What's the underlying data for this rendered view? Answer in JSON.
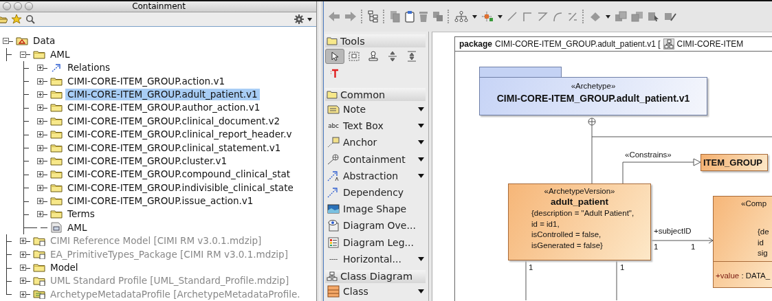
{
  "containment": {
    "title": "Containment",
    "tree": [
      {
        "label": "Data",
        "kind": "data",
        "selected": false,
        "children": [
          {
            "label": "AML",
            "kind": "folder",
            "selected": false,
            "children": [
              {
                "label": "Relations",
                "kind": "relations",
                "selected": false
              },
              {
                "label": "CIMI-CORE-ITEM_GROUP.action.v1",
                "kind": "folder",
                "selected": false
              },
              {
                "label": "CIMI-CORE-ITEM_GROUP.adult_patient.v1",
                "kind": "folder",
                "selected": true
              },
              {
                "label": "CIMI-CORE-ITEM_GROUP.author_action.v1",
                "kind": "folder",
                "selected": false
              },
              {
                "label": "CIMI-CORE-ITEM_GROUP.clinical_document.v2",
                "kind": "folder",
                "selected": false
              },
              {
                "label": "CIMI-CORE-ITEM_GROUP.clinical_report_header.v",
                "kind": "folder",
                "selected": false
              },
              {
                "label": "CIMI-CORE-ITEM_GROUP.clinical_statement.v1",
                "kind": "folder",
                "selected": false
              },
              {
                "label": "CIMI-CORE-ITEM_GROUP.cluster.v1",
                "kind": "folder",
                "selected": false
              },
              {
                "label": "CIMI-CORE-ITEM_GROUP.compound_clinical_stat",
                "kind": "folder",
                "selected": false
              },
              {
                "label": "CIMI-CORE-ITEM_GROUP.indivisible_clinical_state",
                "kind": "folder",
                "selected": false
              },
              {
                "label": "CIMI-CORE-ITEM_GROUP.issue_action.v1",
                "kind": "folder",
                "selected": false
              },
              {
                "label": "Terms",
                "kind": "folder",
                "selected": false
              },
              {
                "label": "AML",
                "kind": "diagram",
                "selected": false
              }
            ]
          },
          {
            "label": "CIMI Reference Model [CIMI RM v3.0.1.mdzip]",
            "kind": "module",
            "selected": false
          },
          {
            "label": "EA_PrimitiveTypes_Package [CIMI RM v3.0.1.mdzip]",
            "kind": "module",
            "selected": false
          },
          {
            "label": "Model",
            "kind": "folder",
            "selected": false
          },
          {
            "label": "UML Standard Profile [UML_Standard_Profile.mdzip]",
            "kind": "module",
            "selected": false
          },
          {
            "label": "ArchetypeMetadataProfile [ArchetypeMetadataProfile.",
            "kind": "profile",
            "selected": false
          }
        ]
      }
    ]
  },
  "palette": {
    "sections": [
      {
        "title": "Tools",
        "kind": "tools",
        "tools": [
          {
            "selected": true
          },
          {
            "selected": false
          },
          {
            "selected": false
          },
          {
            "selected": false
          },
          {
            "selected": false
          },
          {
            "selected": false
          }
        ]
      },
      {
        "title": "Common",
        "kind": "list",
        "items": [
          {
            "label": "Note",
            "kind": "note",
            "menu": true
          },
          {
            "label": "Text Box",
            "kind": "textbox",
            "glyph": "abc",
            "menu": true
          },
          {
            "label": "Anchor",
            "kind": "anchor",
            "menu": true
          },
          {
            "label": "Containment",
            "kind": "containment",
            "menu": true
          },
          {
            "label": "Abstraction",
            "kind": "abstraction",
            "menu": true
          },
          {
            "label": "Dependency",
            "kind": "dependency",
            "menu": false
          },
          {
            "label": "Image Shape",
            "kind": "image",
            "menu": false
          },
          {
            "label": "Diagram Ove...",
            "kind": "overview",
            "menu": false
          },
          {
            "label": "Diagram Leg...",
            "kind": "legend",
            "menu": false
          },
          {
            "label": "Horizontal...",
            "kind": "separator",
            "glyph": "----",
            "menu": true
          }
        ]
      },
      {
        "title": "Class Diagram",
        "kind": "list",
        "items": [
          {
            "label": "Class",
            "kind": "class",
            "menu": true
          }
        ]
      }
    ]
  },
  "diagram": {
    "frame_kind": "package",
    "frame_name": "CIMI-CORE-ITEM_GROUP.adult_patient.v1 [",
    "frame_diagram": "CIMI-CORE-ITEM",
    "package": {
      "stereotype": "«Archetype»",
      "name": "CIMI-CORE-ITEM_GROUP.adult_patient.v1"
    },
    "constraint": {
      "label": "«Constrains»",
      "target": "ITEM_GROUP"
    },
    "class": {
      "stereotype": "«ArchetypeVersion»",
      "name": "adult_patient",
      "properties": [
        "{description = \"Adult Patient\",",
        "id = id1,",
        "isControlled = false,",
        "isGenerated = false}"
      ]
    },
    "association": {
      "role": "+subjectID",
      "source_multiplicity": "1",
      "target_multiplicity": "1"
    },
    "lower_multiplicities": [
      "1",
      "1"
    ],
    "right_class": {
      "stereotype": "«Comp",
      "properties": [
        "{de",
        "id",
        "sig"
      ],
      "attribute_name": "+value",
      "attribute_type": " : DATA_"
    }
  }
}
